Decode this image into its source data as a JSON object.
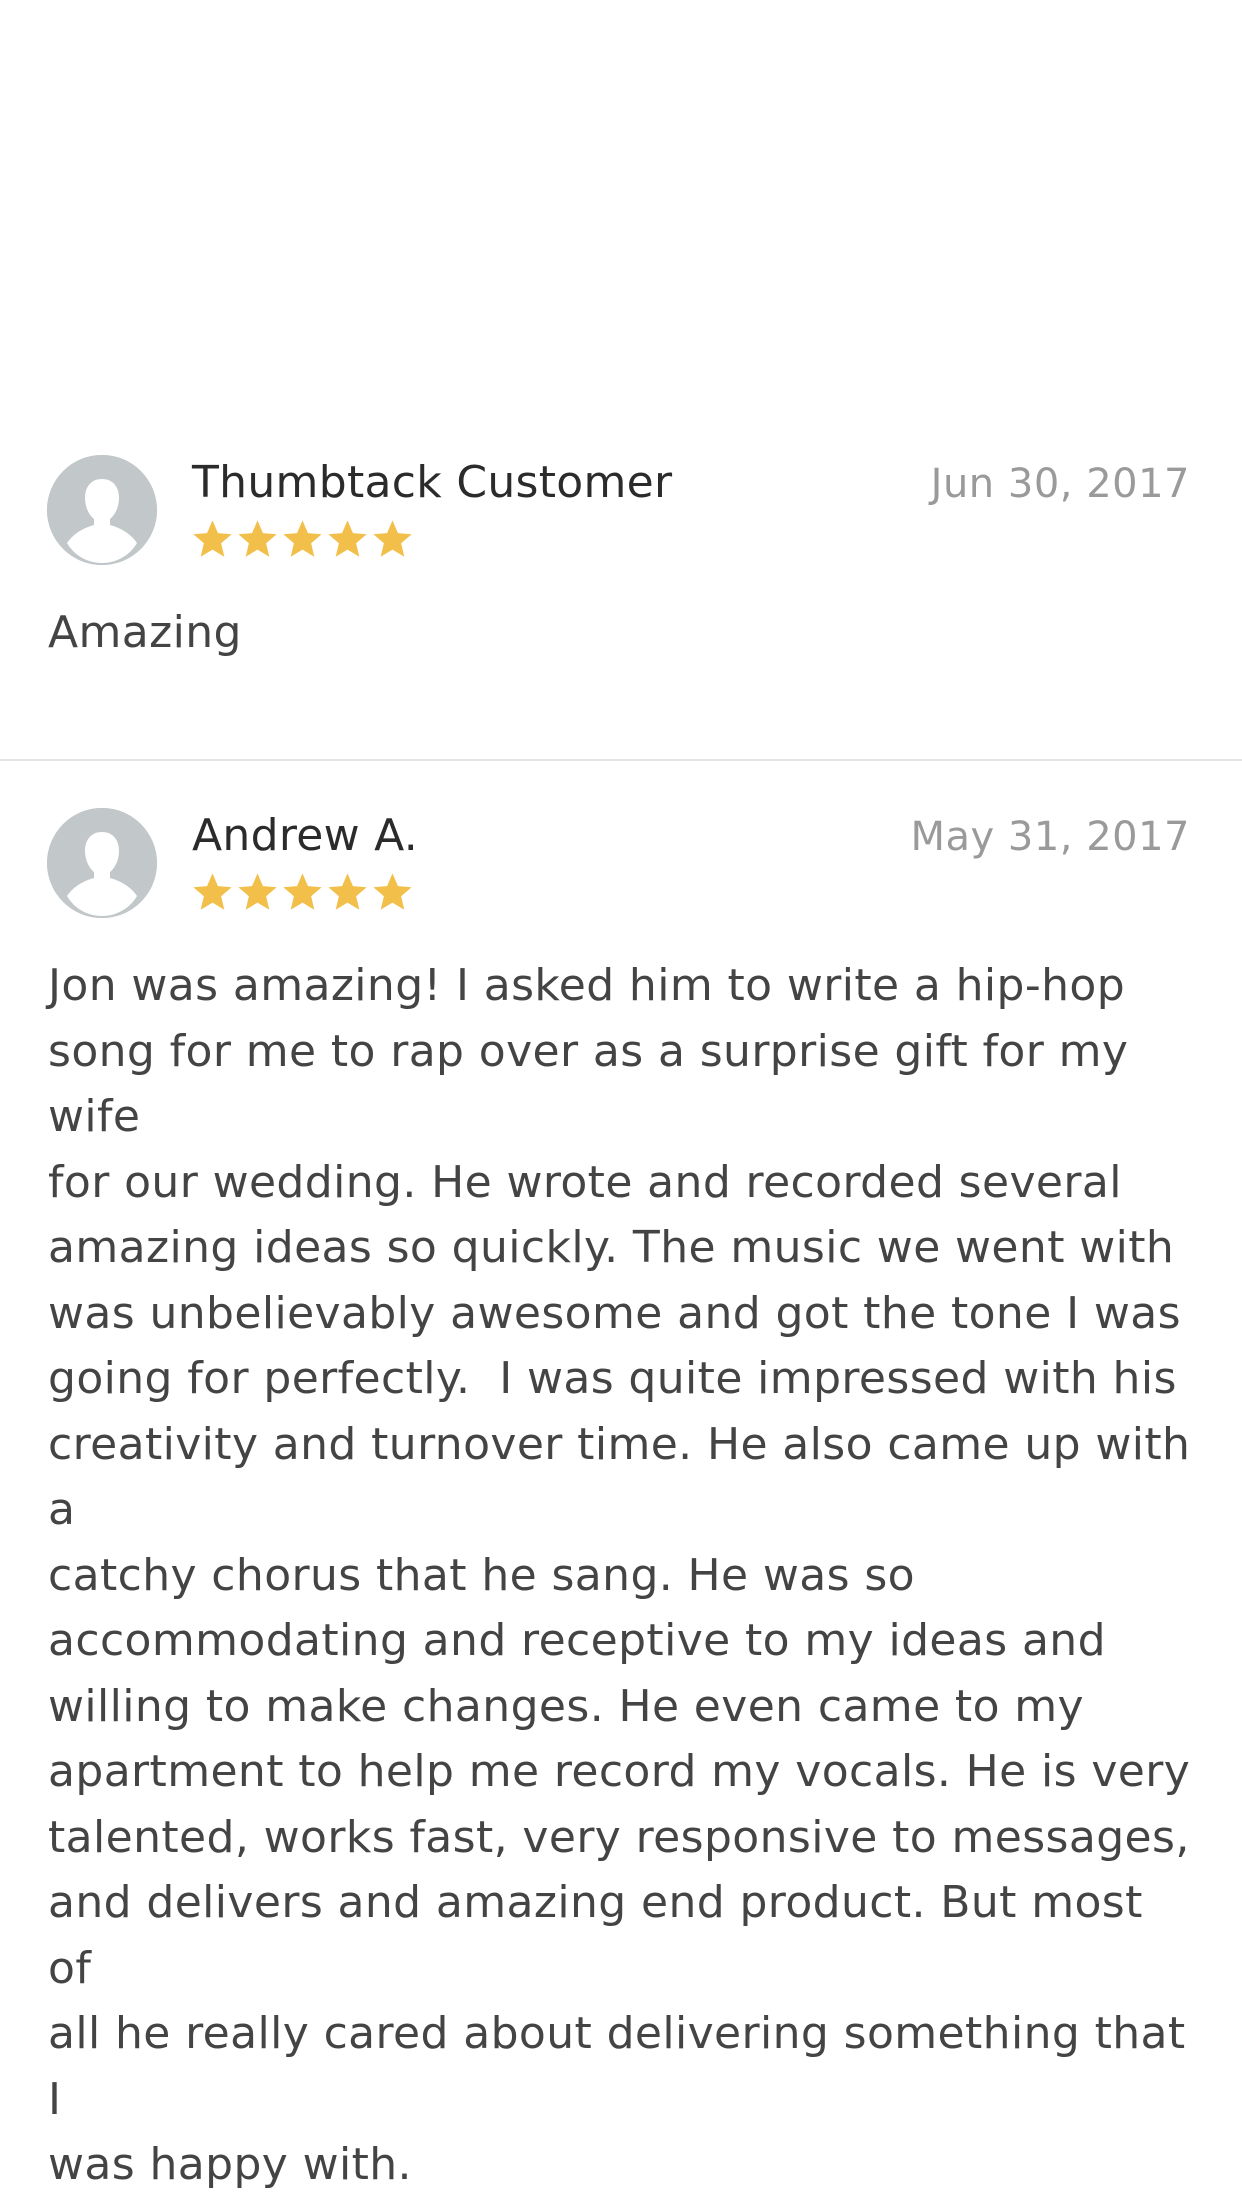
{
  "reviews": [
    {
      "author": "Thumbtack Customer",
      "date": "Jun 30, 2017",
      "rating": 5,
      "max_rating": 5,
      "text": "Amazing"
    },
    {
      "author": "Andrew A.",
      "date": "May 31, 2017",
      "rating": 5,
      "max_rating": 5,
      "text": "Jon was amazing! I asked him to write a hip-hop\nsong for me to rap over as a surprise gift for my wife\nfor our wedding. He wrote and recorded several\namazing ideas so quickly. The music we went with\nwas unbelievably awesome and got the tone I was\ngoing for perfectly.  I was quite impressed with his\ncreativity and turnover time. He also came up with a\ncatchy chorus that he sang. He was so\naccommodating and receptive to my ideas and\nwilling to make changes. He even came to my\napartment to help me record my vocals. He is very\ntalented, works fast, very responsive to messages,\nand delivers and amazing end product. But most of\nall he really cared about delivering something that I\nwas happy with."
    }
  ],
  "colors": {
    "star": "#f2bf4a",
    "avatar_bg": "#c2c7c9",
    "divider": "#e4e4e4",
    "date_text": "#9a9a9a"
  },
  "icons": {
    "avatar": "person-silhouette-icon",
    "star": "star-icon"
  }
}
